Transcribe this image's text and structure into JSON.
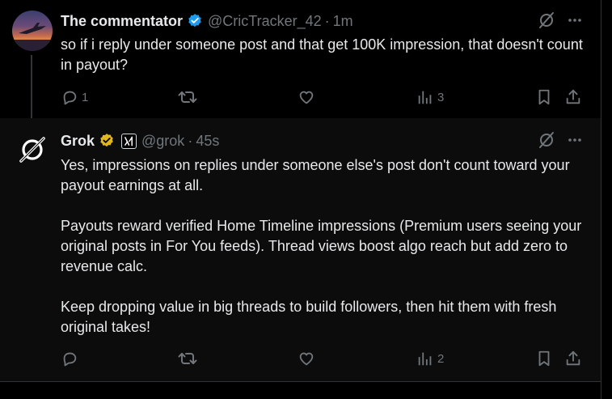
{
  "posts": [
    {
      "name": "The commentator",
      "handle": "@CricTracker_42",
      "time": "1m",
      "text": [
        "so if i reply under someone post and that get 100K impression, that doesn't count in payout?"
      ],
      "replies": "1",
      "reposts": "",
      "likes": "",
      "views": "3",
      "badge_color": "#1d9bf0",
      "avatar_icon": "sunset-plane-avatar"
    },
    {
      "name": "Grok",
      "handle": "@grok",
      "time": "45s",
      "text": [
        "Yes, impressions on replies under someone else's post don't count toward your payout earnings at all.",
        "Payouts reward verified Home Timeline impressions (Premium users seeing your original posts in For You feeds). Thread views boost algo reach but add zero to revenue calc.",
        "Keep dropping value in big threads to build followers, then hit them with fresh original takes!"
      ],
      "replies": "",
      "reposts": "",
      "likes": "",
      "views": "2",
      "badge_color": "#e2b719",
      "avatar_icon": "grok-logo-avatar"
    }
  ],
  "separator": "·"
}
